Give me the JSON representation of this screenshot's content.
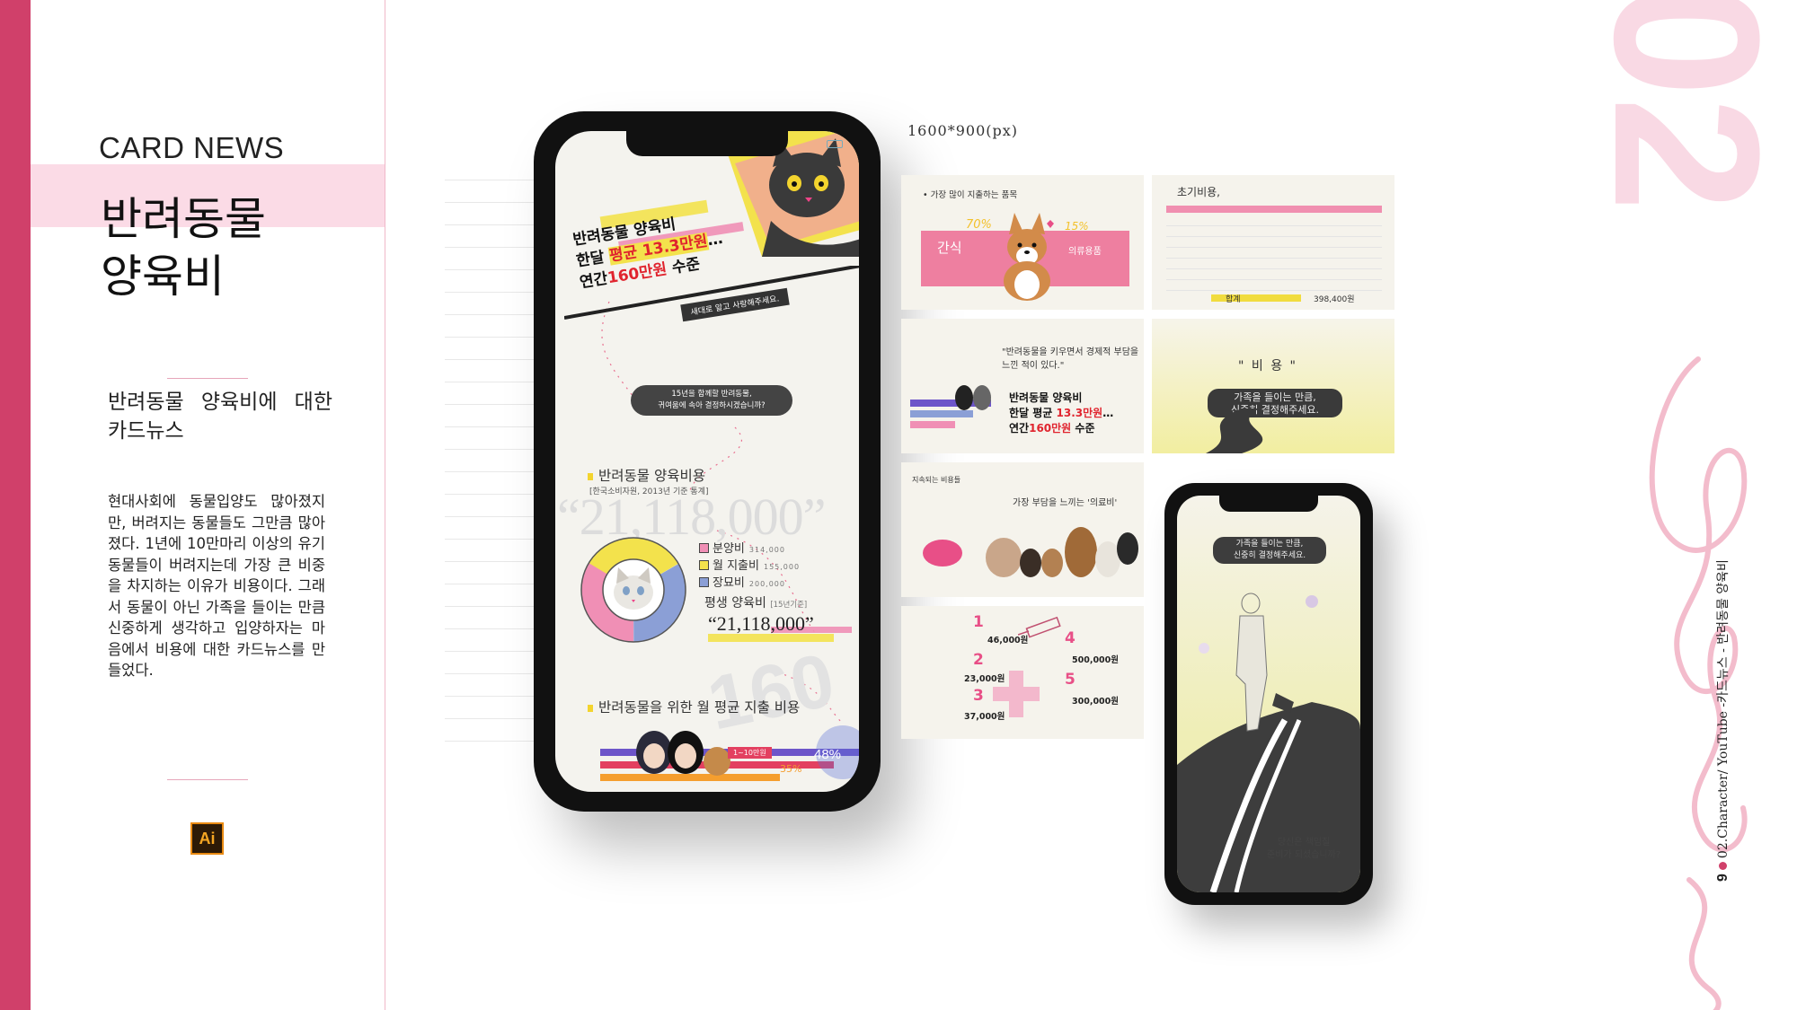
{
  "sidebar": {
    "eyebrow": "CARD NEWS",
    "title_line1": "반려동물",
    "title_line2": "양육비",
    "subtitle": "반려동물 양육비에 대한 카드뉴스",
    "description": "현대사회에 동물입양도 많아졌지만, 버려지는 동물들도 그만큼 많아졌다. 1년에 10만마리 이상의 유기동물들이 버려지는데 가장 큰 비중을 차지하는 이유가 비용이다. 그래서 동물이 아닌 가족을 들이는 만큼 신중하게 생각하고 입양하자는 마음에서 비용에 대한 카드뉴스를 만들었다.",
    "tool_badge": "Ai",
    "colors": {
      "accent": "#d0406a",
      "band": "#fbdbe6"
    }
  },
  "phone_main": {
    "headline_1": "반려동물 양육비",
    "headline_2a": "한달 ",
    "headline_2b": "평균 13.3만원",
    "headline_2c": "…",
    "headline_3a": "연간",
    "headline_3b": "160만원",
    "headline_3c": " 수준",
    "tagline": "새대로 알고 사랑해주세요.",
    "pill_line1": "15년을 함께할 반려동물,",
    "pill_line2": "귀여움에 속아 결정하시겠습니까?",
    "section1_title": "반려동물 양육비용",
    "source": "[한국소비자원, 2013년 기준 통계]",
    "ghost_number": "“21,118,000”",
    "legend": [
      {
        "label": "분양비",
        "note": "314,000",
        "color": "#f08fb5"
      },
      {
        "label": "월 지출비",
        "note": "155,000",
        "color": "#f3e24c"
      },
      {
        "label": "장묘비",
        "note": "200,000",
        "color": "#8b9fd6"
      }
    ],
    "lifetime_label": "평생 양육비",
    "lifetime_note": "[15년기준]",
    "lifetime_value": "“21,118,000”",
    "ghost_160": "160",
    "section2_title": "반려동물을 위한 월 평균 지출 비용",
    "range_label": "1~10만원",
    "pct_48": "48%",
    "pct_35": "35%"
  },
  "size_label": "1600*900(px)",
  "cards": {
    "c1_title": "가장 많이 지출하는 품목",
    "c1_snack": "간식",
    "c1_p70": "70%",
    "c1_p15": "15%",
    "c1_other": "의류용품",
    "c2_title": "초기비용,",
    "c2_sum_label": "합계",
    "c2_sum_value": "398,400원",
    "c3_quote": "\"반려동물을 키우면서 경제적 부담을 느낀 적이 있다.\"",
    "c3_hl1": "반려동물 양육비",
    "c3_hl2a": "한달 평균 ",
    "c3_hl2b": "13.3만원",
    "c3_hl2c": "…",
    "c3_hl3a": "연간",
    "c3_hl3b": "160만원",
    "c3_hl3c": " 수준",
    "c4_cost": "\" 비 용 \"",
    "c4_pill1": "가족을 들이는 만큼,",
    "c4_pill2": "신중히 결정해주세요.",
    "c5_title1": "지속되는 비용들",
    "c5_title2": "가장 부담을 느끼는 '의료비'",
    "c6_items": [
      {
        "n": "1",
        "v": "46,000원"
      },
      {
        "n": "2",
        "v": "23,000원"
      },
      {
        "n": "3",
        "v": "37,000원"
      },
      {
        "n": "4",
        "v": "500,000원"
      },
      {
        "n": "5",
        "v": "300,000원"
      }
    ]
  },
  "phone_small": {
    "pill_line1": "가족을 들이는 만큼,",
    "pill_line2": "신중히 결정해주세요.",
    "question_1": "당신은 책임질",
    "question_2": "준비가 되셨습니까?"
  },
  "right": {
    "big_number": "02",
    "page": "9",
    "vertical_caption": "02.Character/ YouTube -카드뉴스 - 반려동물 양육비",
    "script_word": "Character"
  }
}
